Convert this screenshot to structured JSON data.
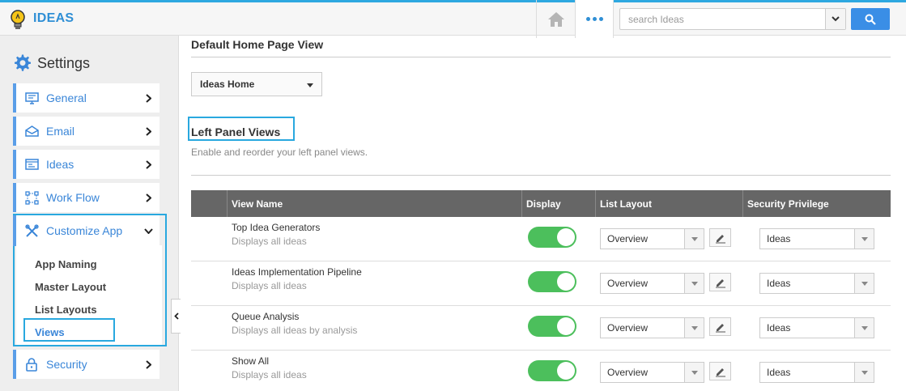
{
  "app": {
    "name": "IDEAS"
  },
  "search": {
    "placeholder": "search Ideas"
  },
  "sidebar": {
    "title": "Settings",
    "items": [
      {
        "label": "General",
        "icon": "monitor-icon"
      },
      {
        "label": "Email",
        "icon": "envelope-icon"
      },
      {
        "label": "Ideas",
        "icon": "list-icon"
      },
      {
        "label": "Work Flow",
        "icon": "workflow-icon"
      }
    ],
    "customize": {
      "label": "Customize App",
      "icon": "tools-icon",
      "sub_items": [
        "App Naming",
        "Master Layout",
        "List Layouts",
        "Views"
      ]
    },
    "security": {
      "label": "Security",
      "icon": "lock-icon"
    }
  },
  "main": {
    "default_home_heading": "Default Home Page View",
    "default_home_value": "Ideas Home",
    "left_panel_title": "Left Panel Views",
    "left_panel_desc": "Enable and reorder your left panel views.",
    "table": {
      "headers": [
        "View Name",
        "Display",
        "List Layout",
        "Security Privilege"
      ],
      "rows": [
        {
          "name": "Top Idea Generators",
          "desc": "Displays all ideas",
          "display": true,
          "layout": "Overview",
          "privilege": "Ideas"
        },
        {
          "name": "Ideas Implementation Pipeline",
          "desc": "Displays all ideas",
          "display": true,
          "layout": "Overview",
          "privilege": "Ideas"
        },
        {
          "name": "Queue Analysis",
          "desc": "Displays all ideas by analysis",
          "display": true,
          "layout": "Overview",
          "privilege": "Ideas"
        },
        {
          "name": "Show All",
          "desc": "Displays all ideas",
          "display": true,
          "layout": "Overview",
          "privilege": "Ideas"
        }
      ]
    }
  },
  "colors": {
    "accent": "#2f8fd5",
    "highlight": "#29a8df",
    "toggle_on": "#4cbf5c",
    "header_bg": "#666666"
  }
}
